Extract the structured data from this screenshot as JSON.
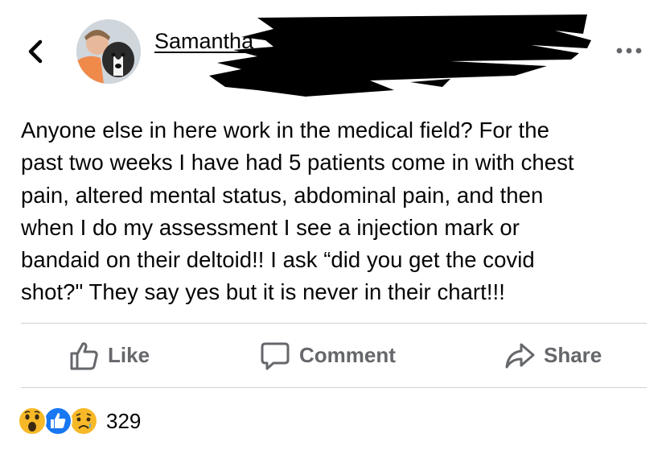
{
  "header": {
    "back_icon": "chevron-left-icon",
    "author_name": "Samantha",
    "more_icon": "more-dots-icon"
  },
  "post": {
    "text_lines": [
      "Anyone else in here work in the medical field? For the",
      "past two weeks I have had 5 patients come in with chest",
      "pain, altered mental status, abdominal pain, and then",
      "when I do my assessment I see a injection mark or",
      "bandaid on their deltoid!! I ask “did you get the covid",
      "shot?\" They say yes but it is never in their chart!!!"
    ]
  },
  "actions": {
    "like_label": "Like",
    "comment_label": "Comment",
    "share_label": "Share"
  },
  "reactions": {
    "icons": [
      "wow-reaction-icon",
      "like-reaction-icon",
      "sad-reaction-icon"
    ],
    "count": "329"
  },
  "colors": {
    "text": "#050505",
    "muted": "#65676b",
    "divider": "#ced0d4",
    "like_blue": "#1877f2",
    "reaction_yellow": "#f7b928"
  }
}
